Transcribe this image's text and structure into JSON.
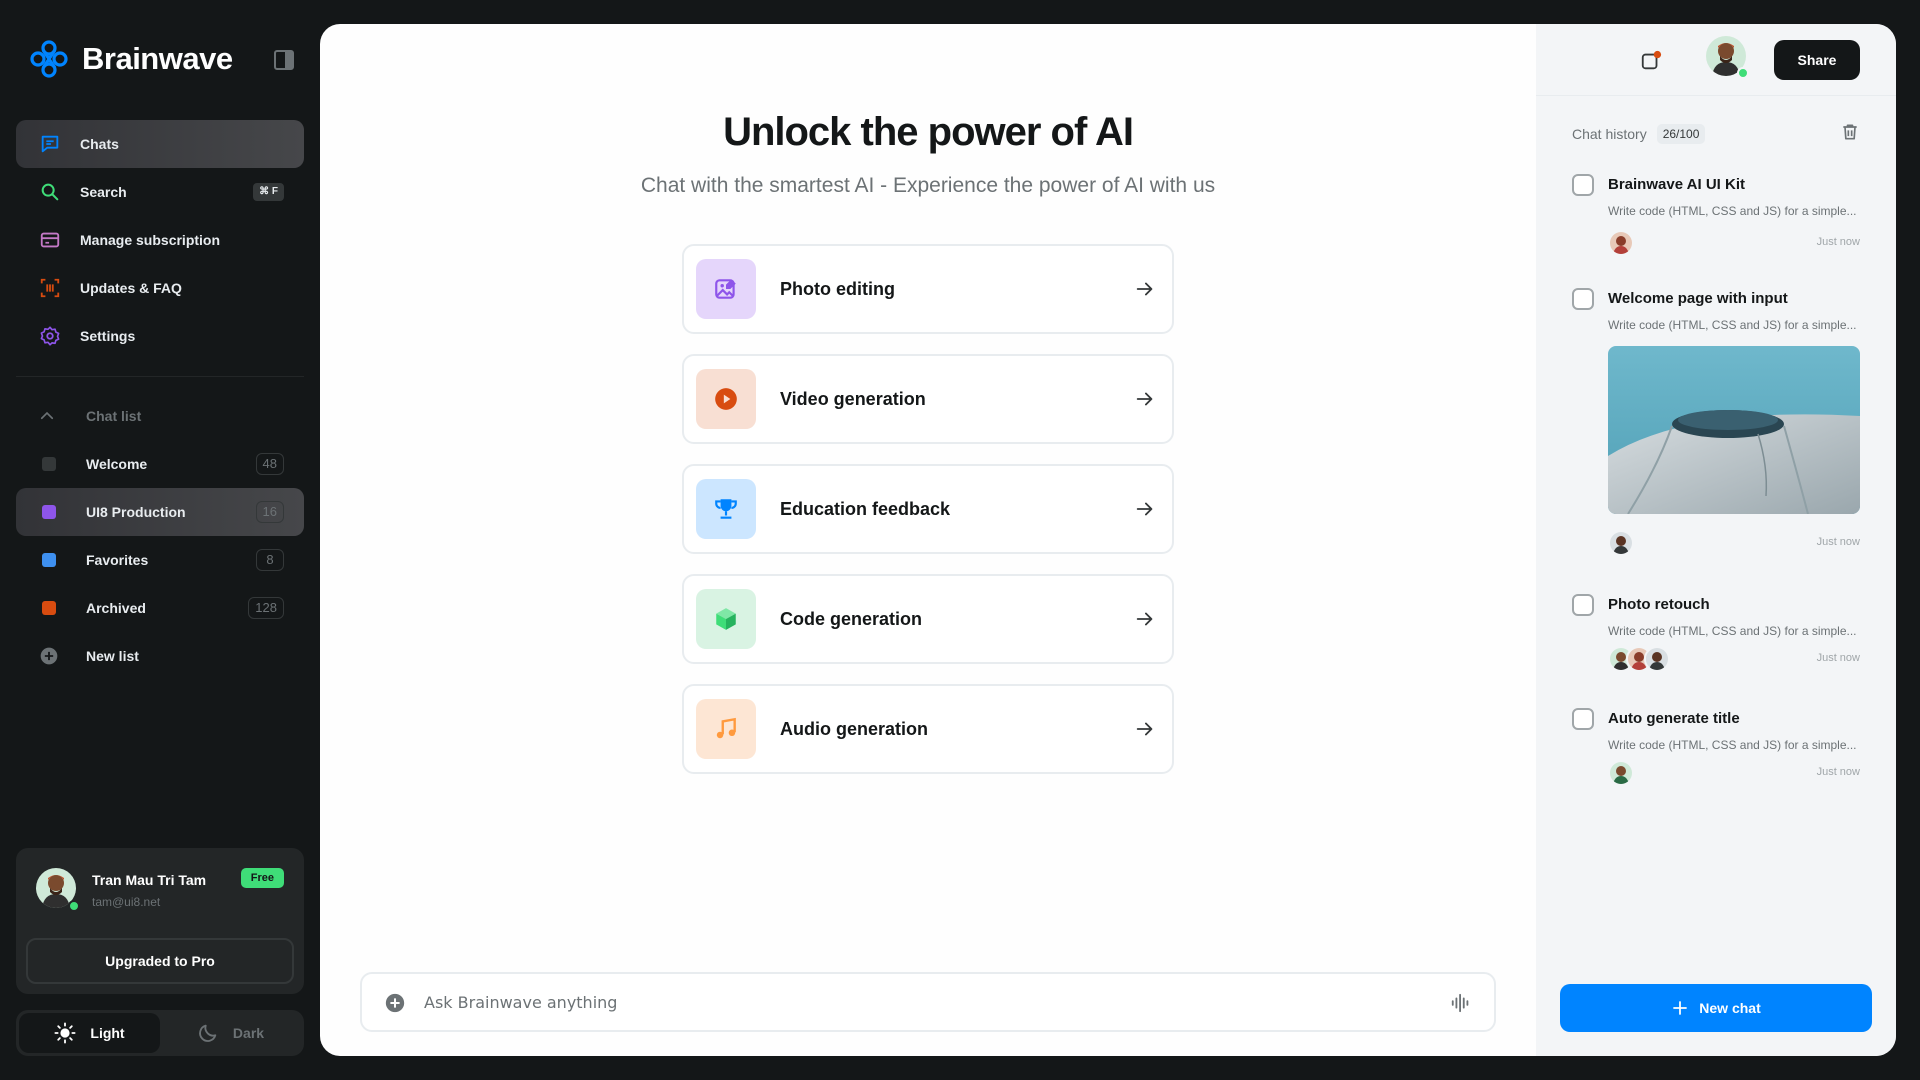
{
  "brand": {
    "name": "Brainwave"
  },
  "nav": {
    "chats": "Chats",
    "search": "Search",
    "search_shortcut": "⌘ F",
    "manage_subscription": "Manage subscription",
    "updates_faq": "Updates & FAQ",
    "settings": "Settings"
  },
  "chat_list": {
    "header": "Chat list",
    "items": [
      {
        "label": "Welcome",
        "count": "48",
        "color": "#343839"
      },
      {
        "label": "UI8 Production",
        "count": "16",
        "color": "#8e55ea"
      },
      {
        "label": "Favorites",
        "count": "8",
        "color": "#3e90f0"
      },
      {
        "label": "Archived",
        "count": "128",
        "color": "#d84c10"
      }
    ],
    "new_list": "New list"
  },
  "profile": {
    "name": "Tran Mau Tri Tam",
    "email": "tam@ui8.net",
    "plan_badge": "Free",
    "upgrade_label": "Upgraded to Pro"
  },
  "theme": {
    "light": "Light",
    "dark": "Dark",
    "selected": "Light"
  },
  "hero": {
    "title": "Unlock the power of AI",
    "subtitle": "Chat with the smartest AI - Experience the power of AI with us"
  },
  "cards": [
    {
      "label": "Photo editing",
      "icon": "photo-edit-icon",
      "bg": "#e5d6fb",
      "fg": "#8e55ea"
    },
    {
      "label": "Video generation",
      "icon": "play-circle-icon",
      "bg": "#f8dfd3",
      "fg": "#d84c10"
    },
    {
      "label": "Education feedback",
      "icon": "trophy-icon",
      "bg": "#cce6ff",
      "fg": "#0084ff"
    },
    {
      "label": "Code generation",
      "icon": "cube-icon",
      "bg": "#d9f3e3",
      "fg": "#3fdd78"
    },
    {
      "label": "Audio generation",
      "icon": "music-note-icon",
      "bg": "#fde6d4",
      "fg": "#ff9a3e"
    }
  ],
  "composer": {
    "placeholder": "Ask Brainwave anything"
  },
  "header_right": {
    "share_label": "Share"
  },
  "history": {
    "header": "Chat history",
    "count": "26/100",
    "items": [
      {
        "title": "Brainwave AI UI Kit",
        "desc": "Write code (HTML, CSS and JS) for a simple...",
        "time": "Just now"
      },
      {
        "title": "Welcome page with input",
        "desc": "Write code (HTML, CSS and JS) for a simple...",
        "time": "Just now"
      },
      {
        "title": "Photo retouch",
        "desc": "Write code (HTML, CSS and JS) for a simple...",
        "time": "Just now"
      },
      {
        "title": "Auto generate title",
        "desc": "Write code (HTML, CSS and JS) for a simple...",
        "time": "Just now"
      }
    ],
    "new_chat_label": "New chat"
  },
  "colors": {
    "accent": "#0084ff",
    "online": "#3fdd78",
    "notif_dot": "#d84c10"
  }
}
